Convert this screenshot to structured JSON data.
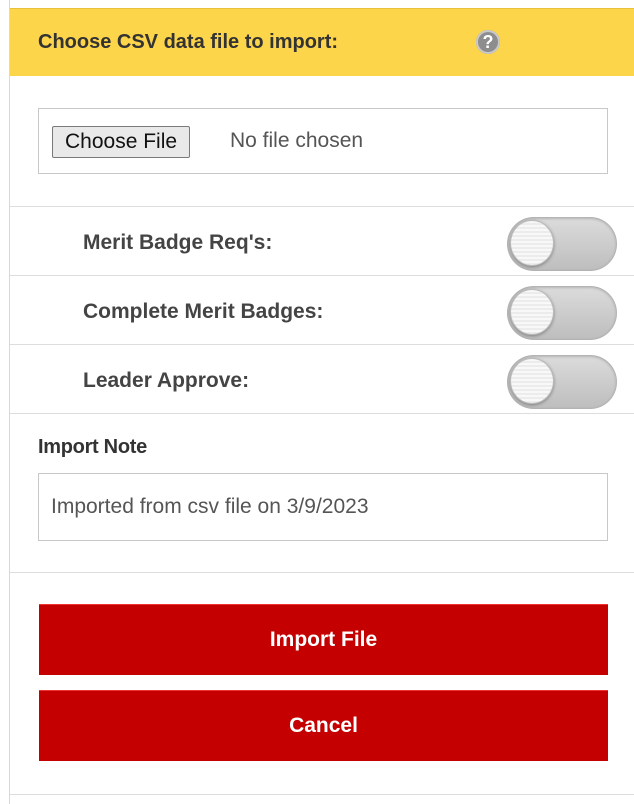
{
  "header": {
    "title": "Choose CSV data file to import:",
    "help_icon": "?"
  },
  "file_input": {
    "button_label": "Choose File",
    "status": "No file chosen"
  },
  "toggles": [
    {
      "label": "Merit Badge Req's:",
      "on": false
    },
    {
      "label": "Complete Merit Badges:",
      "on": false
    },
    {
      "label": "Leader Approve:",
      "on": false
    }
  ],
  "import_note": {
    "label": "Import Note",
    "value": "Imported from csv file on 3/9/2023"
  },
  "actions": {
    "import_label": "Import File",
    "cancel_label": "Cancel"
  },
  "colors": {
    "header_bg": "#fdd54a",
    "button_bg": "#c40000",
    "button_text": "#ffffff"
  }
}
